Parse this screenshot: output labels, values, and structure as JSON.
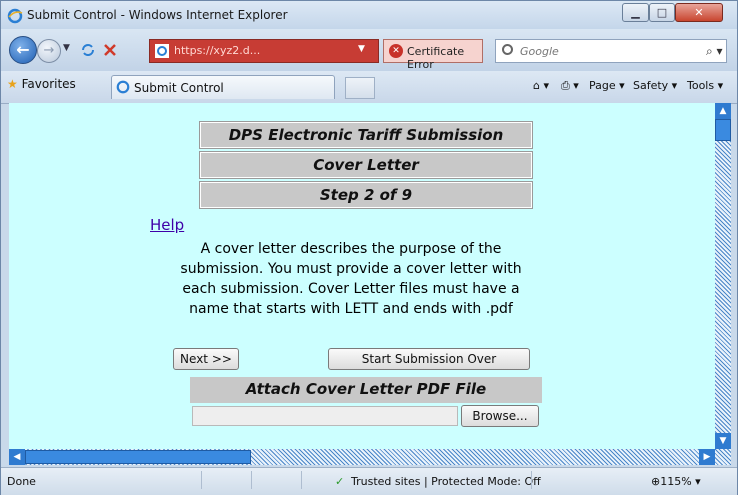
{
  "window": {
    "title": "Submit Control - Windows Internet Explorer"
  },
  "address": {
    "url": "https://xyz2.d...",
    "certificate": "Certificate Error"
  },
  "search": {
    "placeholder": "Google"
  },
  "favorites": {
    "label": "Favorites"
  },
  "tab": {
    "title": "Submit Control"
  },
  "commands": {
    "page": "Page",
    "safety": "Safety",
    "tools": "Tools"
  },
  "content": {
    "header1": "DPS Electronic Tariff Submission",
    "header2": "Cover Letter",
    "header3": "Step 2 of 9",
    "help": "Help",
    "description": [
      "A cover letter describes the purpose of the",
      "submission. You must provide a cover letter with",
      "each submission. Cover Letter files must have a",
      "name that starts with LETT and ends with .pdf"
    ],
    "next_button": "Next >>",
    "start_over_button": "Start Submission Over",
    "attach_header": "Attach Cover Letter PDF File",
    "browse_button": "Browse..."
  },
  "status": {
    "left": "Done",
    "zone": "Trusted sites | Protected Mode: Off",
    "zoom": "115%"
  },
  "colors": {
    "page_bg": "#ccffff",
    "header_bg": "#c8c8c8",
    "link": "#3f00a8",
    "cert_error": "#c73c34"
  },
  "icons": [
    "ie-icon",
    "back-icon",
    "forward-icon",
    "refresh-icon",
    "stop-icon",
    "search-icon",
    "favorites-star-icon",
    "home-icon",
    "print-icon",
    "help-icon",
    "checkmark-icon",
    "zoom-icon"
  ]
}
